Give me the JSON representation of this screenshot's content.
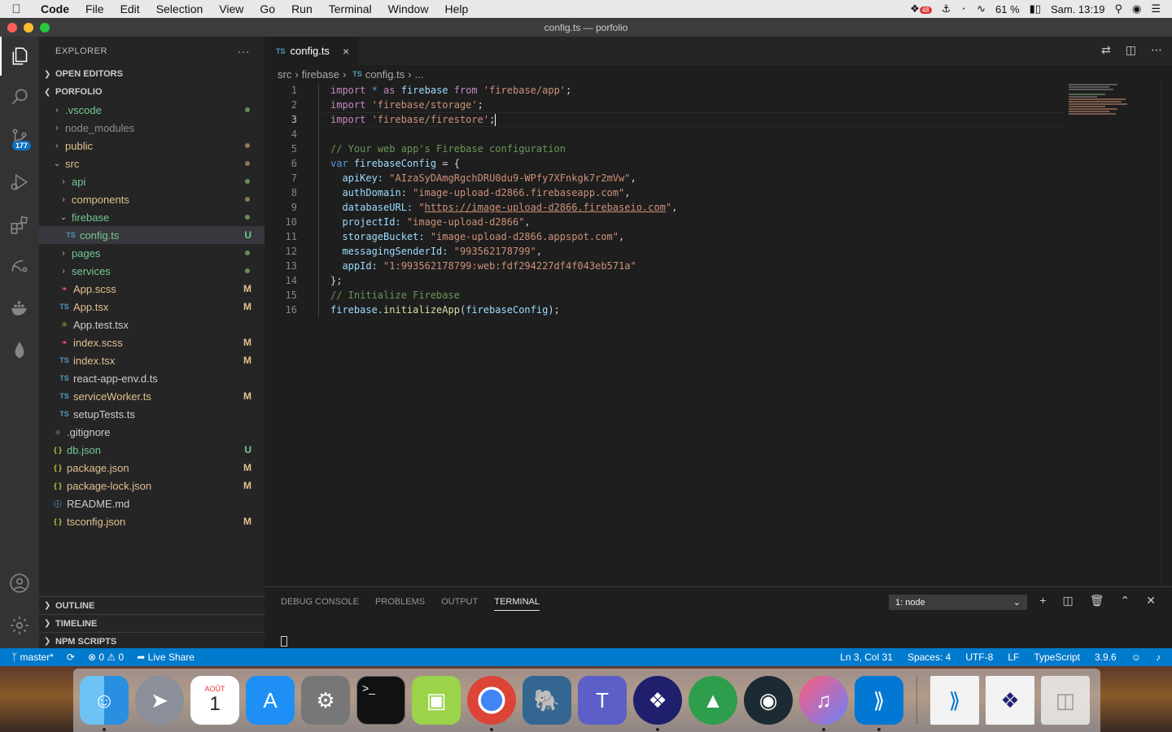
{
  "menubar": {
    "app": "Code",
    "items": [
      "File",
      "Edit",
      "Selection",
      "View",
      "Go",
      "Run",
      "Terminal",
      "Window",
      "Help"
    ],
    "notif_count": "48",
    "battery": "61 %",
    "clock": "Sam. 13:19"
  },
  "window": {
    "title": "config.ts — porfolio"
  },
  "activity": {
    "scm_badge": "177"
  },
  "sidebar": {
    "title": "EXPLORER",
    "more": "···",
    "open_editors": "OPEN EDITORS",
    "project": "PORFOLIO",
    "tree": [
      {
        "label": ".vscode",
        "status": ""
      },
      {
        "label": "node_modules",
        "status": ""
      },
      {
        "label": "public",
        "status": ""
      },
      {
        "label": "src",
        "status": ""
      },
      {
        "label": "api",
        "status": ""
      },
      {
        "label": "components",
        "status": ""
      },
      {
        "label": "firebase",
        "status": ""
      },
      {
        "label": "config.ts",
        "status": "U"
      },
      {
        "label": "pages",
        "status": ""
      },
      {
        "label": "services",
        "status": ""
      },
      {
        "label": "App.scss",
        "status": "M"
      },
      {
        "label": "App.tsx",
        "status": "M"
      },
      {
        "label": "App.test.tsx",
        "status": ""
      },
      {
        "label": "index.scss",
        "status": "M"
      },
      {
        "label": "index.tsx",
        "status": "M"
      },
      {
        "label": "react-app-env.d.ts",
        "status": ""
      },
      {
        "label": "serviceWorker.ts",
        "status": "M"
      },
      {
        "label": "setupTests.ts",
        "status": ""
      },
      {
        "label": ".gitignore",
        "status": ""
      },
      {
        "label": "db.json",
        "status": "U"
      },
      {
        "label": "package.json",
        "status": "M"
      },
      {
        "label": "package-lock.json",
        "status": "M"
      },
      {
        "label": "README.md",
        "status": ""
      },
      {
        "label": "tsconfig.json",
        "status": "M"
      }
    ],
    "outline": "OUTLINE",
    "timeline": "TIMELINE",
    "npm_scripts": "NPM SCRIPTS"
  },
  "editor": {
    "tab": {
      "icon": "TS",
      "label": "config.ts",
      "close": "×"
    },
    "breadcrumb": {
      "part1": "src",
      "part2": "firebase",
      "icon": "TS",
      "file": "config.ts",
      "rest": "..."
    },
    "lines": [
      {
        "n": "1"
      },
      {
        "n": "2"
      },
      {
        "n": "3"
      },
      {
        "n": "4"
      },
      {
        "n": "5"
      },
      {
        "n": "6"
      },
      {
        "n": "7"
      },
      {
        "n": "8"
      },
      {
        "n": "9"
      },
      {
        "n": "10"
      },
      {
        "n": "11"
      },
      {
        "n": "12"
      },
      {
        "n": "13"
      },
      {
        "n": "14"
      },
      {
        "n": "15"
      },
      {
        "n": "16"
      }
    ],
    "code": {
      "l1_import": "import",
      "l1_star": " * ",
      "l1_as": "as",
      "l1_ns": " firebase ",
      "l1_from": "from",
      "l1_mod": " 'firebase/app'",
      "l1_end": ";",
      "l2_import": "import",
      "l2_mod": " 'firebase/storage'",
      "l2_end": ";",
      "l3_import": "import",
      "l3_mod": " 'firebase/firestore'",
      "l3_end": ";",
      "l5_comment": "// Your web app's Firebase configuration",
      "l6_var": "var",
      "l6_name": " firebaseConfig",
      "l6_rest": " = {",
      "l7_key": "  apiKey:",
      "l7_val": " \"AIzaSyDAmgRgchDRU0du9-WPfy7XFnkgk7r2mVw\"",
      "l8_key": "  authDomain:",
      "l8_val": " \"image-upload-d2866.firebaseapp.com\"",
      "l9_key": "  databaseURL:",
      "l9_q1": " \"",
      "l9_url": "https://image-upload-d2866.firebaseio.com",
      "l9_q2": "\"",
      "l10_key": "  projectId:",
      "l10_val": " \"image-upload-d2866\"",
      "l11_key": "  storageBucket:",
      "l11_val": " \"image-upload-d2866.appspot.com\"",
      "l12_key": "  messagingSenderId:",
      "l12_val": " \"993562178799\"",
      "l13_key": "  appId:",
      "l13_val": " \"1:993562178799:web:fdf294227df4f043eb571a\"",
      "comma": ",",
      "l14": "};",
      "l15_comment": "// Initialize Firebase",
      "l16_obj": "firebase",
      "l16_dot": ".",
      "l16_fn": "initializeApp",
      "l16_open": "(",
      "l16_arg": "firebaseConfig",
      "l16_close": ");"
    }
  },
  "panel": {
    "tabs": [
      "DEBUG CONSOLE",
      "PROBLEMS",
      "OUTPUT",
      "TERMINAL"
    ],
    "terminal_select": "1: node"
  },
  "statusbar": {
    "branch": "master*",
    "errors": "0",
    "warnings": "0",
    "live_share": "Live Share",
    "position": "Ln 3, Col 31",
    "spaces": "Spaces: 4",
    "encoding": "UTF-8",
    "eol": "LF",
    "language": "TypeScript",
    "version": "3.9.6"
  },
  "dock": {
    "calendar_month": "AOÛT",
    "calendar_day": "1",
    "terminal_prompt": ">_"
  },
  "colors": {
    "accent": "#007acc",
    "modified": "#e2c08d",
    "untracked": "#73c991"
  }
}
